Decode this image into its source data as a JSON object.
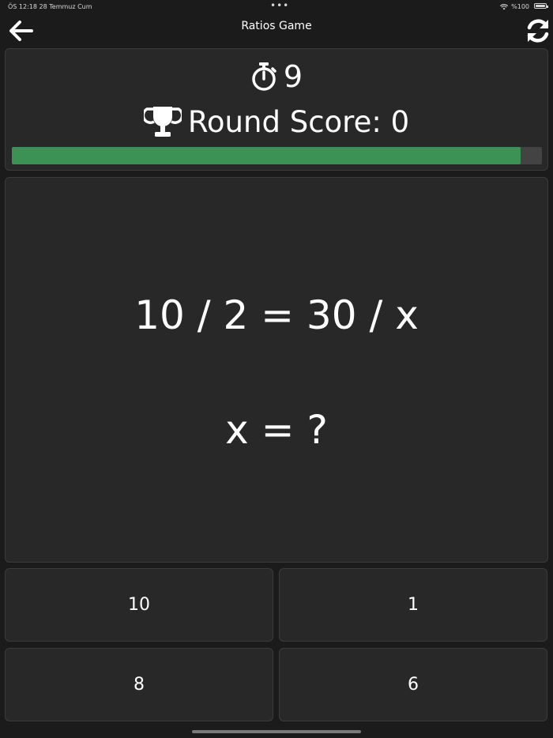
{
  "status_bar": {
    "time_date": "ÖS 12:18   28 Temmuz Cum",
    "battery": "%100",
    "icons": [
      "wifi-icon",
      "battery-icon"
    ]
  },
  "nav": {
    "title": "Ratios Game",
    "back_icon": "arrow-left-icon",
    "refresh_icon": "refresh-icon"
  },
  "header": {
    "timer_icon": "stopwatch-icon",
    "timer_value": "9",
    "score_icon": "trophy-icon",
    "score_text": "Round Score: 0",
    "progress_percent": 96,
    "colors": {
      "progress_fill": "#3c9155",
      "progress_track": "#434343"
    }
  },
  "question": {
    "equation": "10 / 2 = 30 / x",
    "prompt": "x = ?"
  },
  "answers": [
    "10",
    "1",
    "8",
    "6"
  ],
  "colors": {
    "background": "#1b1b1b",
    "panel": "#282828",
    "text": "#ffffff"
  }
}
